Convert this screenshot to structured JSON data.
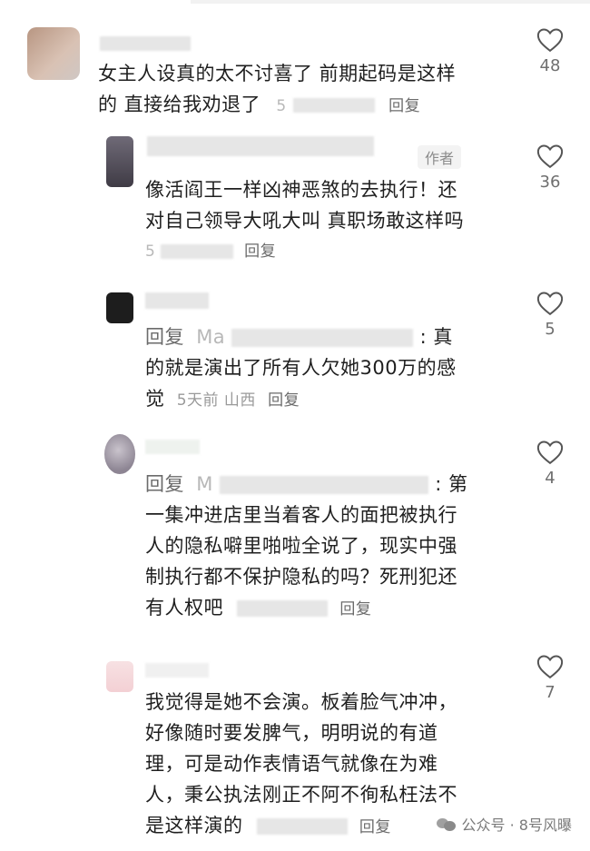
{
  "comments": [
    {
      "line1": "女主人设真的太不讨喜了 前期起码是这样",
      "line2": "的 直接给我劝退了",
      "meta": "5",
      "reply_label": "回复",
      "likes": "48"
    },
    {
      "author_tag": "作者",
      "line1": "像活阎王一样凶神恶煞的去执行！还",
      "line2": "对自己领导大吼大叫 真职场敢这样吗",
      "meta": "5",
      "reply_label": "回复",
      "likes": "36"
    },
    {
      "prefix": "回复",
      "name_partial": "Ma",
      "line1_end": ": 真",
      "line2": "的就是演出了所有人欠她300万的感",
      "line3": "觉",
      "meta": "5天前 山西",
      "reply_label": "回复",
      "likes": "5"
    },
    {
      "prefix": "回复",
      "name_partial": "M",
      "line1_end": ": 第",
      "line2": "一集冲进店里当着客人的面把被执行",
      "line3": "人的隐私噼里啪啦全说了，现实中强",
      "line4": "制执行都不保护隐私的吗？死刑犯还",
      "line5": "有人权吧",
      "reply_label": "回复",
      "likes": "4"
    },
    {
      "line1": "我觉得是她不会演。板着脸气冲冲，",
      "line2": "好像随时要发脾气，明明说的有道",
      "line3": "理，可是动作表情语气就像在为难",
      "line4": "人，秉公执法刚正不阿不徇私枉法不",
      "line5": "是这样演的",
      "reply_label": "回复",
      "likes": "7"
    }
  ],
  "watermark": {
    "text": "公众号 · 8号风曝"
  }
}
